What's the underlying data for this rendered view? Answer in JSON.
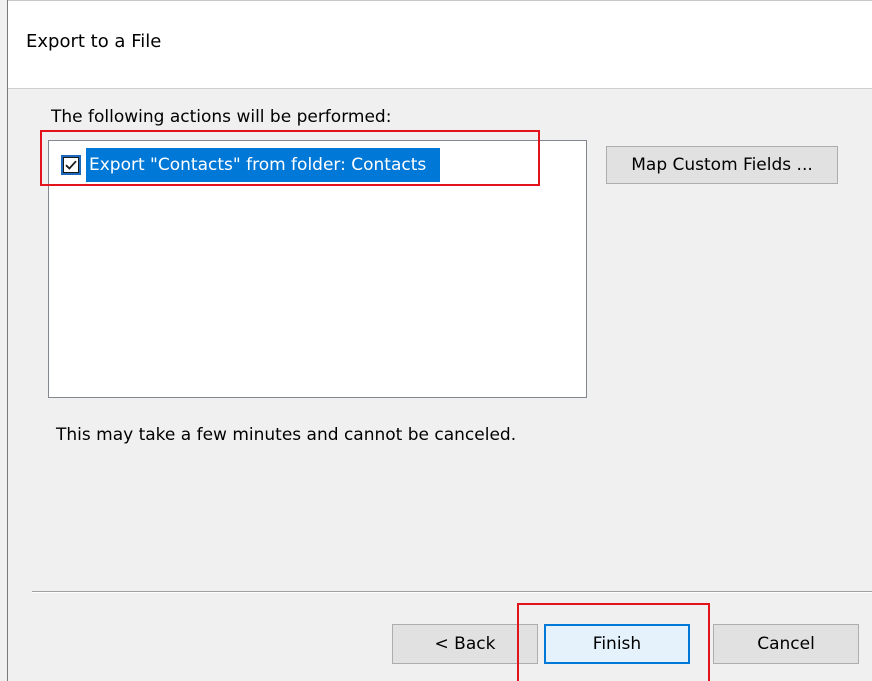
{
  "dialog": {
    "title": "Export to a File"
  },
  "actions": {
    "label": "The following actions will be performed:",
    "items": [
      {
        "text": "Export \"Contacts\" from folder: Contacts",
        "checked": true
      }
    ]
  },
  "buttons": {
    "map_fields": "Map Custom Fields ...",
    "back": "< Back",
    "finish": "Finish",
    "cancel": "Cancel"
  },
  "note": "This may take a few minutes and cannot be canceled.",
  "colors": {
    "selection": "#0078d7",
    "highlight_annotation": "#e2131b",
    "dialog_background": "#f0f0f0"
  },
  "icons": {
    "checkbox": "checked-checkbox-icon"
  }
}
